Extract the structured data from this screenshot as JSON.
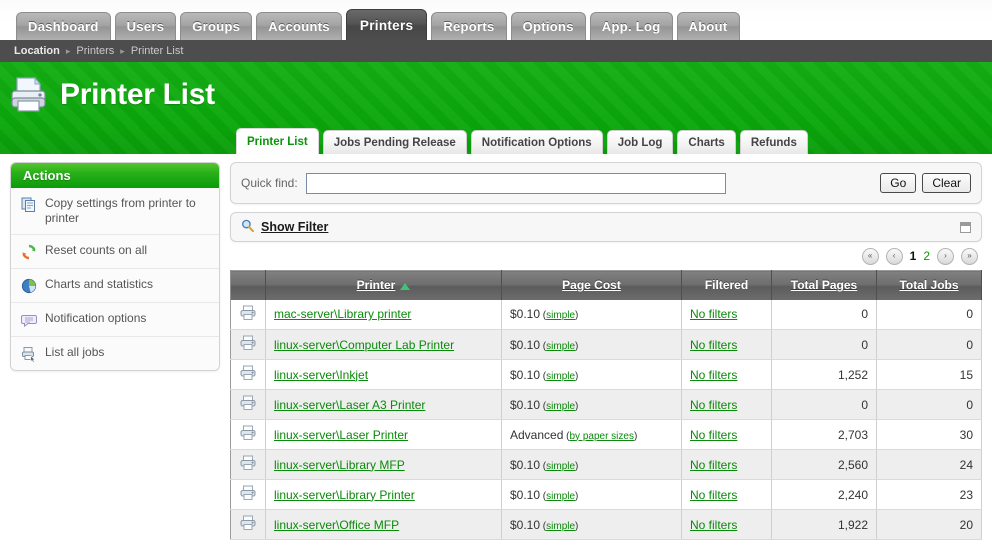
{
  "topnav": {
    "tabs": [
      {
        "label": "Dashboard",
        "active": false
      },
      {
        "label": "Users",
        "active": false
      },
      {
        "label": "Groups",
        "active": false
      },
      {
        "label": "Accounts",
        "active": false
      },
      {
        "label": "Printers",
        "active": true
      },
      {
        "label": "Reports",
        "active": false
      },
      {
        "label": "Options",
        "active": false
      },
      {
        "label": "App. Log",
        "active": false
      },
      {
        "label": "About",
        "active": false
      }
    ]
  },
  "breadcrumb": {
    "label": "Location",
    "separator": "▸",
    "items": [
      "Printers",
      "Printer List"
    ]
  },
  "header": {
    "title": "Printer List",
    "icon": "printer-icon",
    "green": "#0aa60a"
  },
  "subtabs": [
    {
      "label": "Printer List",
      "active": true
    },
    {
      "label": "Jobs Pending Release",
      "active": false
    },
    {
      "label": "Notification Options",
      "active": false
    },
    {
      "label": "Job Log",
      "active": false
    },
    {
      "label": "Charts",
      "active": false
    },
    {
      "label": "Refunds",
      "active": false
    }
  ],
  "sidebar": {
    "title": "Actions",
    "items": [
      {
        "label": "Copy settings from printer to printer",
        "icon": "copy-icon"
      },
      {
        "label": "Reset counts on all",
        "icon": "reset-icon"
      },
      {
        "label": "Charts and statistics",
        "icon": "pie-chart-icon"
      },
      {
        "label": "Notification options",
        "icon": "speech-bubble-icon"
      },
      {
        "label": "List all jobs",
        "icon": "job-list-icon"
      }
    ]
  },
  "quickfind": {
    "label": "Quick find:",
    "value": "",
    "placeholder": "",
    "go_label": "Go",
    "clear_label": "Clear"
  },
  "filterbar": {
    "label": "Show Filter",
    "icon": "magnifier-icon",
    "collapse_icon": "collapse-icon"
  },
  "pager": {
    "first": "«",
    "prev": "‹",
    "next": "›",
    "last": "»",
    "pages": [
      {
        "label": "1",
        "current": true
      },
      {
        "label": "2",
        "current": false
      }
    ]
  },
  "table": {
    "columns": [
      {
        "label": "",
        "sortable": false
      },
      {
        "label": "Printer",
        "sortable": true,
        "sorted": "asc"
      },
      {
        "label": "Page Cost",
        "sortable": true
      },
      {
        "label": "Filtered",
        "sortable": false
      },
      {
        "label": "Total Pages",
        "sortable": true
      },
      {
        "label": "Total Jobs",
        "sortable": true
      }
    ],
    "rows": [
      {
        "icon": "printer-icon",
        "name": "mac-server\\Library printer",
        "cost": "$0.10",
        "cost_sub": "simple",
        "filtered": "No filters",
        "pages": "0",
        "jobs": "0"
      },
      {
        "icon": "printer-icon",
        "name": "linux-server\\Computer Lab Printer",
        "cost": "$0.10",
        "cost_sub": "simple",
        "filtered": "No filters",
        "pages": "0",
        "jobs": "0"
      },
      {
        "icon": "printer-icon",
        "name": "linux-server\\Inkjet",
        "cost": "$0.10",
        "cost_sub": "simple",
        "filtered": "No filters",
        "pages": "1,252",
        "jobs": "15"
      },
      {
        "icon": "printer-icon",
        "name": "linux-server\\Laser A3 Printer",
        "cost": "$0.10",
        "cost_sub": "simple",
        "filtered": "No filters",
        "pages": "0",
        "jobs": "0"
      },
      {
        "icon": "printer-icon",
        "name": "linux-server\\Laser Printer",
        "cost": "Advanced",
        "cost_sub": "by paper sizes",
        "filtered": "No filters",
        "pages": "2,703",
        "jobs": "30"
      },
      {
        "icon": "printer-icon",
        "name": "linux-server\\Library MFP",
        "cost": "$0.10",
        "cost_sub": "simple",
        "filtered": "No filters",
        "pages": "2,560",
        "jobs": "24"
      },
      {
        "icon": "printer-icon",
        "name": "linux-server\\Library Printer",
        "cost": "$0.10",
        "cost_sub": "simple",
        "filtered": "No filters",
        "pages": "2,240",
        "jobs": "23"
      },
      {
        "icon": "printer-icon",
        "name": "linux-server\\Office MFP",
        "cost": "$0.10",
        "cost_sub": "simple",
        "filtered": "No filters",
        "pages": "1,922",
        "jobs": "20"
      }
    ]
  }
}
